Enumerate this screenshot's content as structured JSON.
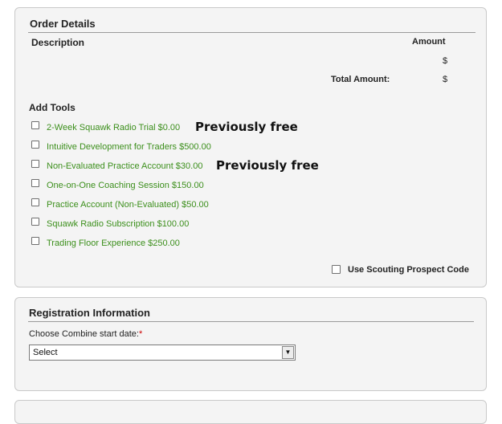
{
  "order": {
    "title": "Order Details",
    "description_header": "Description",
    "amount_header": "Amount",
    "row_currency": "$",
    "total_label": "Total Amount:",
    "total_currency": "$",
    "add_tools_title": "Add Tools",
    "tools": [
      {
        "label": "2-Week Squawk Radio Trial $0.00",
        "checked": false,
        "annotation": "Previously free"
      },
      {
        "label": "Intuitive Development for Traders $500.00",
        "checked": false
      },
      {
        "label": "Non-Evaluated Practice Account $30.00",
        "checked": false,
        "annotation": "Previously free"
      },
      {
        "label": "One-on-One Coaching Session $150.00",
        "checked": false
      },
      {
        "label": "Practice Account (Non-Evaluated) $50.00",
        "checked": false
      },
      {
        "label": "Squawk Radio Subscription $100.00",
        "checked": false
      },
      {
        "label": "Trading Floor Experience $250.00",
        "checked": false
      }
    ],
    "scouting_label": "Use Scouting Prospect Code"
  },
  "registration": {
    "title": "Registration Information",
    "date_label": "Choose Combine start date:",
    "required_mark": "*",
    "select_value": "Select"
  },
  "colors": {
    "tool_link": "#3c8f1c",
    "required": "#cc0000",
    "panel_bg": "#f4f4f4"
  }
}
